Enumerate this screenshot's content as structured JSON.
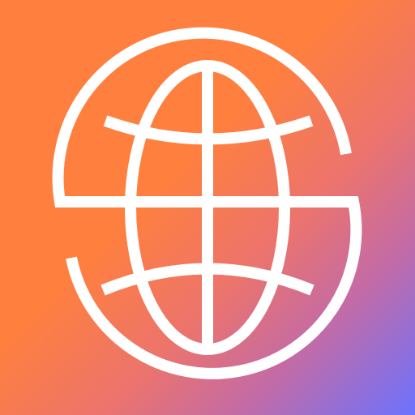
{
  "icon": {
    "name": "globe-s-logo",
    "colors": {
      "gradient_warm": "#FF7F3F",
      "gradient_mid": "#F27F61",
      "gradient_pink": "#D7698B",
      "gradient_purple": "#A56DC8",
      "gradient_blue": "#6B72FF",
      "stroke": "#FFFFFF"
    }
  }
}
